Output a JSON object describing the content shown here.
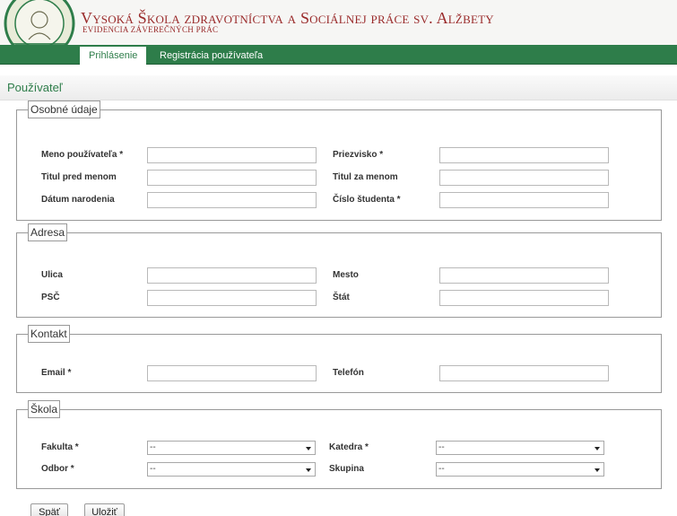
{
  "header": {
    "title": "Vysoká Škola zdravotníctva a Sociálnej  práce sv. Alžbety",
    "subtitle": "EVIDENCIA ZÁVEREČNÝCH PRÁC",
    "logo_icon": "university-seal-icon"
  },
  "nav": {
    "tabs": [
      {
        "label": "Prihlásenie",
        "active": true
      },
      {
        "label": "Registrácia používateľa",
        "active": false
      }
    ]
  },
  "page": {
    "title": "Používateľ"
  },
  "sections": {
    "personal": {
      "legend": "Osobné údaje",
      "username_label": "Meno používateľa *",
      "surname_label": "Priezvisko *",
      "title_before_label": "Titul pred menom",
      "title_after_label": "Titul za menom",
      "birthdate_label": "Dátum narodenia",
      "student_number_label": "Číslo študenta *",
      "username_value": "",
      "surname_value": "",
      "title_before_value": "",
      "title_after_value": "",
      "birthdate_value": "",
      "student_number_value": ""
    },
    "address": {
      "legend": "Adresa",
      "street_label": "Ulica",
      "city_label": "Mesto",
      "zip_label": "PSČ",
      "state_label": "Štát",
      "street_value": "",
      "city_value": "",
      "zip_value": "",
      "state_value": ""
    },
    "contact": {
      "legend": "Kontakt",
      "email_label": "Email *",
      "phone_label": "Telefón",
      "email_value": "",
      "phone_value": ""
    },
    "school": {
      "legend": "Škola",
      "faculty_label": "Fakulta *",
      "department_label": "Katedra *",
      "field_label": "Odbor *",
      "group_label": "Skupina",
      "faculty_value": "--",
      "department_value": "--",
      "field_value": "--",
      "group_value": "--"
    }
  },
  "buttons": {
    "back": "Späť",
    "save": "Uložiť"
  },
  "colors": {
    "brand_green": "#2e7d4a",
    "title_red": "#9a2b2b"
  }
}
